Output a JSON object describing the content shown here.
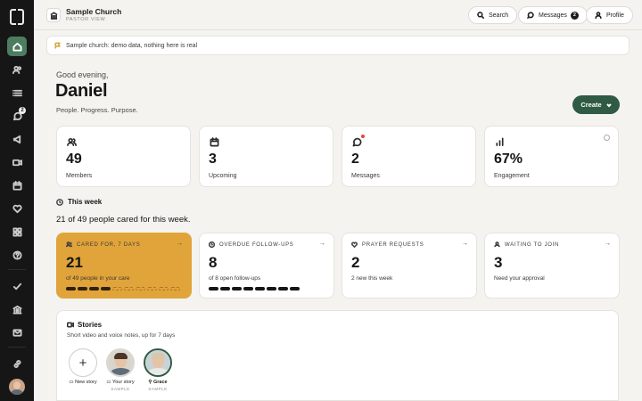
{
  "header": {
    "church_name": "Sample Church",
    "view_label": "PASTOR VIEW",
    "search_label": "Search",
    "messages_label": "Messages",
    "messages_count": "2",
    "profile_label": "Profile"
  },
  "sidebar": {
    "items": [
      {
        "icon": "home-icon",
        "active": true
      },
      {
        "icon": "people-icon"
      },
      {
        "icon": "list-icon"
      },
      {
        "icon": "chat-icon",
        "badge": "2"
      },
      {
        "icon": "megaphone-icon"
      },
      {
        "icon": "video-icon"
      },
      {
        "icon": "calendar-icon"
      },
      {
        "icon": "heart-icon"
      },
      {
        "icon": "grid-icon"
      },
      {
        "icon": "help-icon"
      },
      {
        "icon": "check-icon"
      },
      {
        "icon": "bank-icon"
      },
      {
        "icon": "mail-icon"
      },
      {
        "icon": "link-icon"
      }
    ]
  },
  "banner": {
    "text": "Sample church: demo data, nothing here is real"
  },
  "greeting": {
    "salutation": "Good evening,",
    "name": "Daniel",
    "tagline": "People. Progress. Purpose.",
    "create_label": "Create"
  },
  "stats": [
    {
      "value": "49",
      "label": "Members",
      "icon": "people-icon"
    },
    {
      "value": "3",
      "label": "Upcoming",
      "icon": "calendar-icon"
    },
    {
      "value": "2",
      "label": "Messages",
      "icon": "chat-icon"
    },
    {
      "value": "67%",
      "label": "Engagement",
      "icon": "bar-chart-icon"
    }
  ],
  "this_week": {
    "heading": "This week",
    "summary": "21 of 49 people cared for this week.",
    "cards": [
      {
        "title": "CARED FOR, 7 DAYS",
        "value": "21",
        "sub": "of 49 people in your care",
        "progress": {
          "filled": 4,
          "total": 10
        }
      },
      {
        "title": "OVERDUE FOLLOW-UPS",
        "value": "8",
        "sub": "of 8 open follow-ups",
        "progress": {
          "filled": 8,
          "total": 8
        }
      },
      {
        "title": "PRAYER REQUESTS",
        "value": "2",
        "sub": "2 new this week"
      },
      {
        "title": "WAITING TO JOIN",
        "value": "3",
        "sub": "Need your approval"
      }
    ]
  },
  "stories": {
    "title": "Stories",
    "description": "Short video and voice notes, up for 7 days",
    "items": [
      {
        "label": "New story"
      },
      {
        "label": "Your story",
        "tag": "SAMPLE"
      },
      {
        "label": "Grace",
        "tag": "SAMPLE"
      }
    ]
  }
}
